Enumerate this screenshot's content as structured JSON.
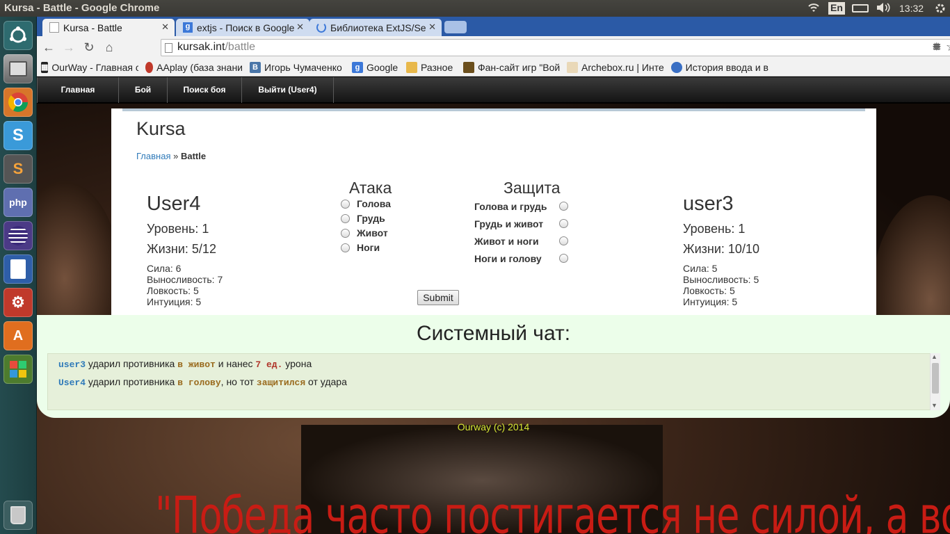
{
  "os": {
    "window_title": "Kursa - Battle - Google Chrome",
    "keyboard_layout": "En",
    "clock": "13:32"
  },
  "launcher": {
    "items": [
      "ubuntu-dash",
      "files",
      "chrome",
      "skype",
      "sublime-text",
      "php-storm",
      "eclipse",
      "libreoffice-writer",
      "system-settings",
      "ubuntu-software-center",
      "crossover",
      "trash"
    ]
  },
  "browser": {
    "tabs": [
      {
        "label": "Kursa - Battle",
        "active": true
      },
      {
        "label": "extjs - Поиск в Google",
        "active": false
      },
      {
        "label": "Библиотека ExtJS/Se",
        "active": false
      }
    ],
    "url_host": "kursak.int",
    "url_path": "/battle",
    "bookmarks": [
      {
        "label": "OurWay - Главная с",
        "icon": "ourway-icon"
      },
      {
        "label": "AAplay (база знани",
        "icon": "aaplay-icon"
      },
      {
        "label": "Игорь Чумаченко",
        "icon": "vk-icon"
      },
      {
        "label": "Google",
        "icon": "google-icon"
      },
      {
        "label": "Разное",
        "icon": "folder-icon"
      },
      {
        "label": "Фан-сайт игр \"Вой",
        "icon": "fansite-icon"
      },
      {
        "label": "Archebox.ru | Инте",
        "icon": "archebox-icon"
      },
      {
        "label": "История ввода и в",
        "icon": "globe-icon"
      }
    ]
  },
  "site": {
    "nav": [
      "Главная",
      "Бой",
      "Поиск боя",
      "Выйти (User4)"
    ],
    "name": "Kursa",
    "breadcrumb_home": "Главная",
    "breadcrumb_sep": " » ",
    "breadcrumb_current": "Battle"
  },
  "battle": {
    "player": {
      "name": "User4",
      "level": "Уровень: 1",
      "hp": "Жизни: 5/12",
      "attrs": [
        "Сила: 6",
        "Выносливость: 7",
        "Ловкость: 5",
        "Интуиция: 5"
      ]
    },
    "opponent": {
      "name": "user3",
      "level": "Уровень: 1",
      "hp": "Жизни: 10/10",
      "attrs": [
        "Сила: 5",
        "Выносливость: 5",
        "Ловкость: 5",
        "Интуиция: 5"
      ]
    },
    "attack_title": "Атака",
    "attack_options": [
      "Голова",
      "Грудь",
      "Живот",
      "Ноги"
    ],
    "defense_title": "Защита",
    "defense_options": [
      "Голова и грудь",
      "Грудь и живот",
      "Живот и ноги",
      "Ноги и голову"
    ],
    "submit": "Submit"
  },
  "chat": {
    "title": "Системный чат:",
    "lines": [
      {
        "user": "user3",
        "t1": " ударил противника ",
        "hit": "в живот",
        "t2": " и нанес ",
        "dmg": "7 ед.",
        "t3": " урона"
      },
      {
        "user": "User4",
        "t1": " ударил противника ",
        "hit": "в голову",
        "t2": ", но тот ",
        "dmg": "защитился",
        "t3": " от удара"
      }
    ]
  },
  "footer": "Ourway (c) 2014",
  "background_quote": "\"Победа часто постигается не силой, а волей\" (Спартак)",
  "colors": {
    "accent_link": "#2f7ab9",
    "chat_hit": "#9a6b1e",
    "chat_damage": "#b0352a",
    "footer": "#d7e734",
    "quote": "#c81c14"
  }
}
